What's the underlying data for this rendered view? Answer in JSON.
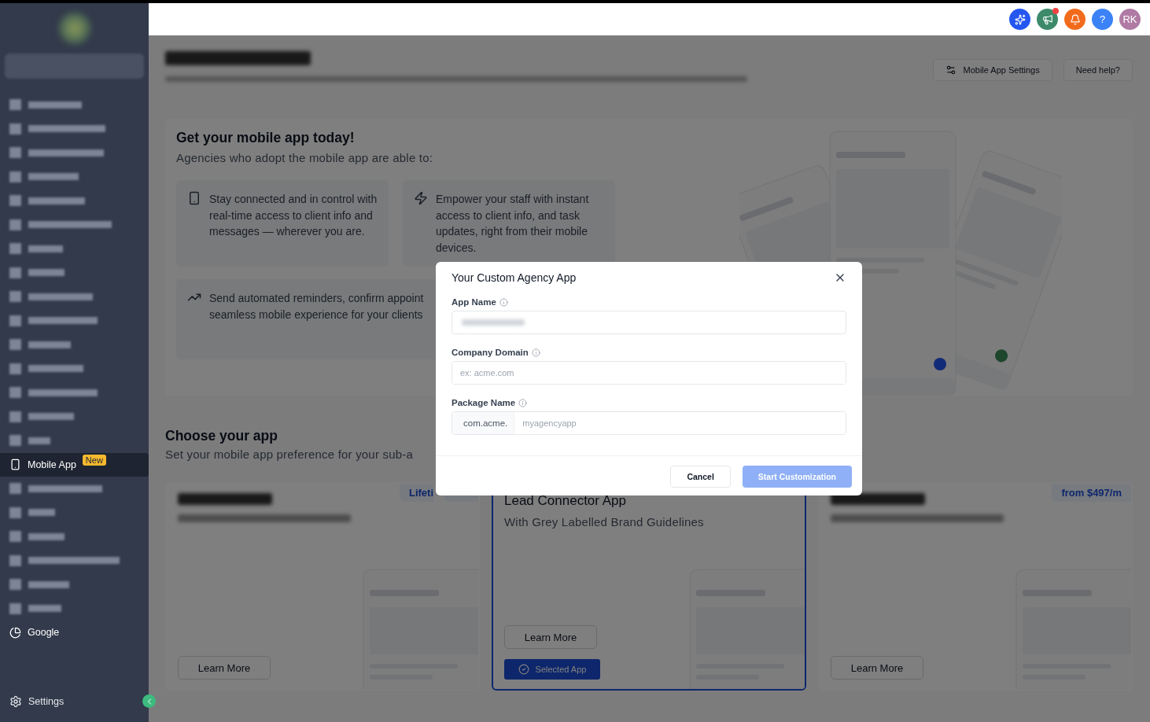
{
  "sidebar": {
    "items": [
      {
        "kind": "blurred",
        "selected": false
      },
      {
        "kind": "blurred",
        "selected": false
      },
      {
        "kind": "blurred",
        "selected": false
      },
      {
        "kind": "blurred",
        "selected": false
      },
      {
        "kind": "blurred",
        "selected": false
      },
      {
        "kind": "blurred",
        "selected": false
      },
      {
        "kind": "blurred",
        "selected": false
      },
      {
        "kind": "blurred",
        "selected": false
      },
      {
        "kind": "blurred",
        "selected": false
      },
      {
        "kind": "blurred",
        "selected": false
      },
      {
        "kind": "blurred",
        "selected": false
      },
      {
        "kind": "blurred",
        "selected": false
      },
      {
        "kind": "blurred",
        "selected": false
      },
      {
        "kind": "blurred",
        "selected": false
      },
      {
        "kind": "blurred",
        "selected": false
      },
      {
        "kind": "mobile",
        "label": "Mobile App",
        "badge": "New",
        "selected": true
      },
      {
        "kind": "blurred",
        "selected": false
      },
      {
        "kind": "blurred",
        "selected": false
      },
      {
        "kind": "blurred",
        "selected": false
      },
      {
        "kind": "blurred",
        "selected": false
      },
      {
        "kind": "blurred",
        "selected": false
      },
      {
        "kind": "blurred",
        "selected": false
      },
      {
        "kind": "google",
        "label": "Google",
        "selected": false
      }
    ],
    "settings": {
      "label": "Settings"
    }
  },
  "header": {
    "buttons": [
      {
        "kind": "ai"
      },
      {
        "kind": "announcements",
        "has_notification": true
      },
      {
        "kind": "notifications"
      },
      {
        "kind": "help",
        "label": "?"
      },
      {
        "kind": "avatar",
        "initials": "RK"
      }
    ]
  },
  "page": {
    "actions": [
      {
        "kind": "settings",
        "label": "Mobile App Settings"
      },
      {
        "kind": "plain",
        "label": "Need help?"
      }
    ]
  },
  "promo": {
    "title": "Get your mobile app today!",
    "subtitle": "Agencies who adopt the mobile app are able to:",
    "features": [
      {
        "kind": "phone",
        "lines": [
          "Stay connected and in control with real-time access to client info and messages — wherever you are."
        ]
      },
      {
        "kind": "bolt",
        "lines": [
          "Empower your staff with instant access to client info, and task updates, right from their mobile devices."
        ]
      },
      {
        "kind": "trend",
        "lines": [
          "Send automated reminders, confirm appoint",
          "seamless mobile experience for your clients"
        ]
      }
    ]
  },
  "choose": {
    "title": "Choose your app",
    "subtitle": "Set your mobile app preference for your sub-a",
    "cards": [
      {
        "kind": "blurred",
        "badge": "Lifeti",
        "badge_cut_by_dialog": true,
        "learn_more": "Learn More",
        "selected": false
      },
      {
        "kind": "titled",
        "title": "Lead Connector App",
        "subtitle": "With Grey Labelled Brand Guidelines",
        "learn_more": "Learn More",
        "selected_label": "Selected App",
        "selected": true
      },
      {
        "kind": "blurred",
        "badge": "from $497/m",
        "learn_more": "Learn More",
        "selected": false
      }
    ]
  },
  "modal": {
    "title": "Your Custom Agency App",
    "fields": [
      {
        "kind": "blurred",
        "label": "App Name"
      },
      {
        "kind": "text",
        "label": "Company Domain",
        "placeholder": "ex: acme.com"
      },
      {
        "kind": "prefixed",
        "label": "Package Name",
        "prefix": "com.acme.",
        "placeholder": "myagencyapp"
      }
    ],
    "buttons": [
      {
        "kind": "secondary",
        "label": "Cancel"
      },
      {
        "kind": "primary",
        "label": "Start Customization",
        "disabled": true
      }
    ]
  }
}
